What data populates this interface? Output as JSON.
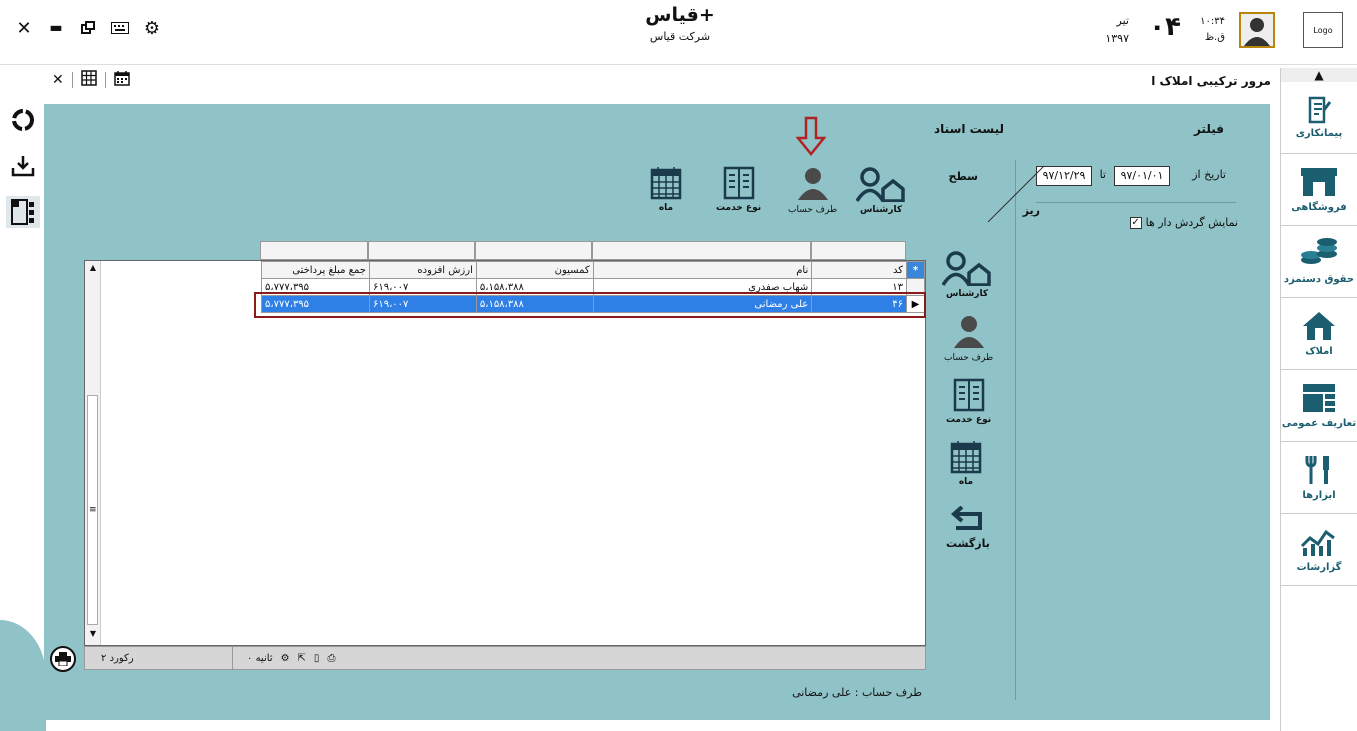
{
  "header": {
    "app_title": "قیاس+",
    "company": "شرکت قیاس",
    "logo_text": "Logo",
    "time": "۱۰:۳۴",
    "time_suffix": "ق.ظ",
    "day": "۰۴",
    "month": "تیر",
    "year": "۱۳۹۷"
  },
  "window_controls": [
    "close-icon",
    "minimize-icon",
    "restore-icon",
    "keyboard-icon",
    "gear-icon"
  ],
  "page": {
    "heading": "مرور ترکیبی املاک ا"
  },
  "filter": {
    "title": "فیلتر",
    "date_from_label": "تاریخ از",
    "date_from": "۹۷/۰۱/۰۱",
    "date_to_label": "تا",
    "date_to": "۹۷/۱۲/۲۹",
    "show_turnover_label": "نمایش گردش دار ها",
    "show_turnover_checked": true
  },
  "docs": {
    "title": "لیست اسناد",
    "level_label": "سطح",
    "detail_label": "ریز",
    "top_levels": [
      "کارشناس",
      "طرف حساب",
      "نوع خدمت",
      "ماه"
    ],
    "side_levels": [
      "کارشناس",
      "طرف حساب",
      "نوع خدمت",
      "ماه"
    ],
    "back_label": "بازگشت"
  },
  "grid": {
    "columns": [
      "کد",
      "نام",
      "کمسیون",
      "ارزش افزوده",
      "جمع مبلغ پرداختی"
    ],
    "rows": [
      {
        "code": "۱۳",
        "name": "شهاب صفدری",
        "commission": "۵،۱۵۸،۳۸۸",
        "vat": "۶۱۹،۰۰۷",
        "total": "۵،۷۷۷،۳۹۵",
        "selected": false
      },
      {
        "code": "۴۶",
        "name": "علی رمضانی",
        "commission": "۵،۱۵۸،۳۸۸",
        "vat": "۶۱۹،۰۰۷",
        "total": "۵،۷۷۷،۳۹۵",
        "selected": true
      }
    ],
    "header_marker": "*",
    "record_count": "۲ رکورد",
    "seconds": "۰ ثانیه"
  },
  "footer": {
    "account_info": "طرف حساب : علی رمضانی"
  },
  "sidebar": {
    "items": [
      {
        "label": "پیمانکاری",
        "icon": "contract-icon"
      },
      {
        "label": "فروشگاهی",
        "icon": "store-icon"
      },
      {
        "label": "حقوق دستمزد",
        "icon": "coins-icon"
      },
      {
        "label": "املاک",
        "icon": "house-icon"
      },
      {
        "label": "تعاریف عمومی",
        "icon": "definitions-icon"
      },
      {
        "label": "ابزارها",
        "icon": "tools-icon"
      },
      {
        "label": "گزارشات",
        "icon": "reports-icon"
      }
    ]
  },
  "colors": {
    "panel_teal": "#8fc3c8",
    "selection_blue": "#2f80e6",
    "highlight_red": "#8b1a1a",
    "sidebar_icon": "#1b5e70"
  }
}
